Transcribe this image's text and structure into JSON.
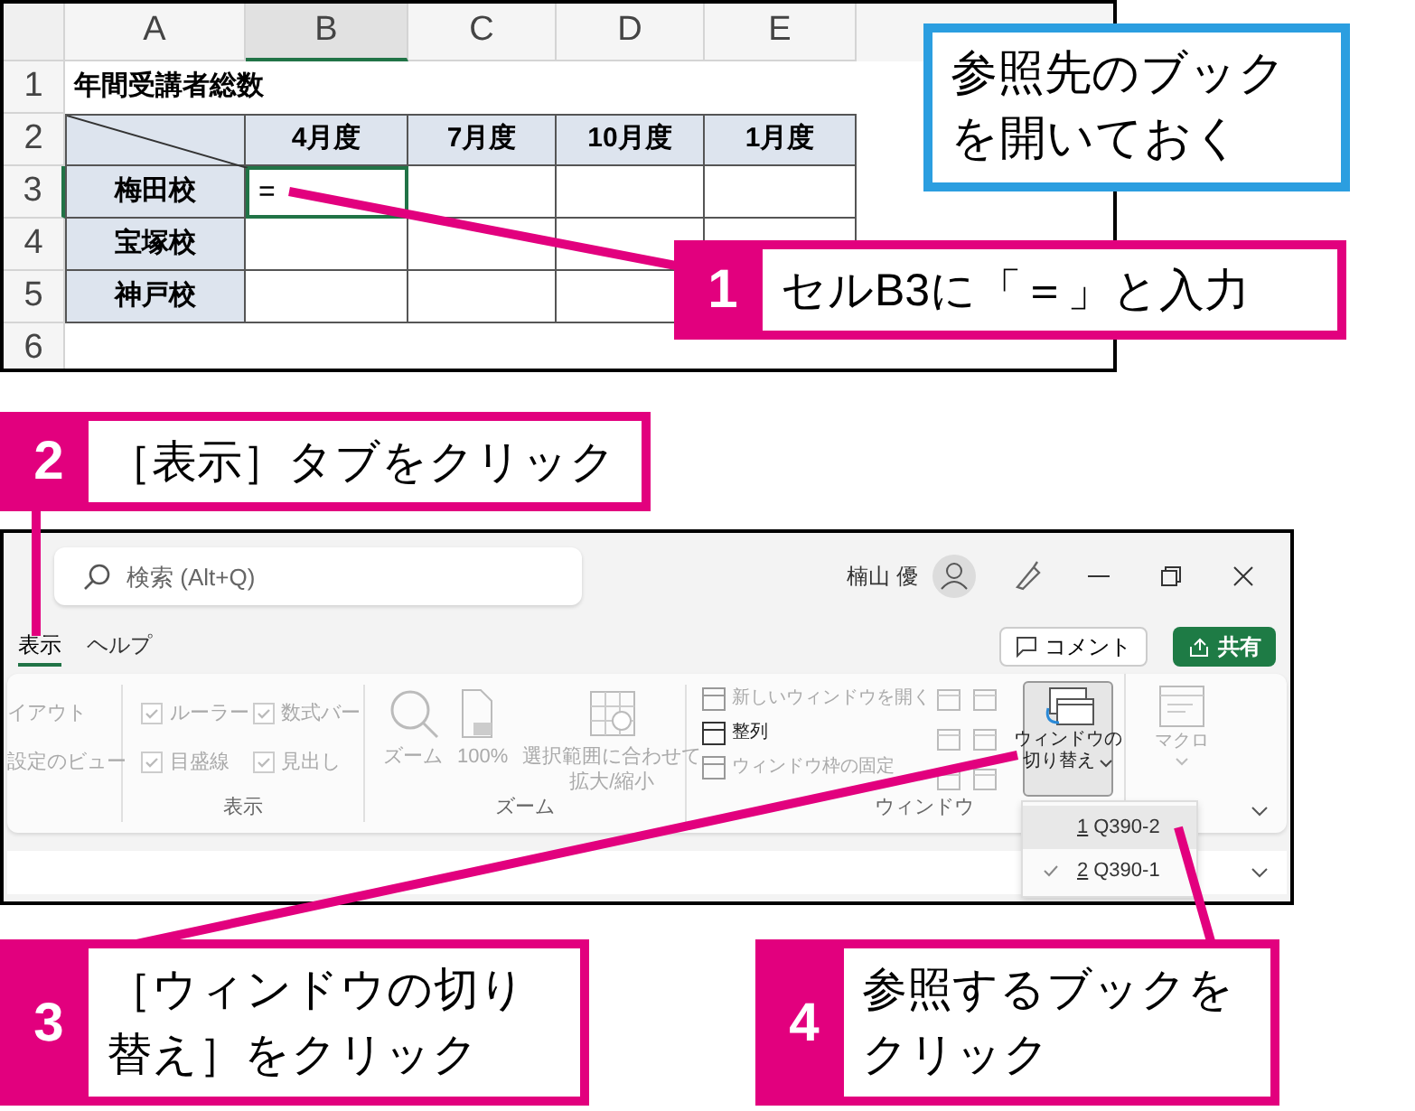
{
  "spreadsheet": {
    "columns": [
      {
        "label": "A",
        "selected": false
      },
      {
        "label": "B",
        "selected": true
      },
      {
        "label": "C",
        "selected": false
      },
      {
        "label": "D",
        "selected": false
      },
      {
        "label": "E",
        "selected": false
      }
    ],
    "rows": [
      {
        "kind": "title",
        "number": "1",
        "selected": false,
        "text": "年間受講者総数"
      },
      {
        "kind": "header",
        "number": "2",
        "selected": false,
        "headers": [
          "4月度",
          "7月度",
          "10月度",
          "1月度"
        ]
      },
      {
        "kind": "data",
        "number": "3",
        "selected": true,
        "label": "梅田校",
        "values": [
          "="
        ]
      },
      {
        "kind": "data",
        "number": "4",
        "selected": false,
        "label": "宝塚校"
      },
      {
        "kind": "data",
        "number": "5",
        "selected": false,
        "label": "神戸校"
      },
      {
        "kind": "empty",
        "number": "6",
        "selected": false
      }
    ]
  },
  "note": "参照先のブックを開いておく",
  "excel": {
    "search": {
      "placeholder": "検索 (Alt+Q)"
    },
    "user": "楠山 優",
    "tabs": [
      {
        "label": "表示",
        "selected": true
      },
      {
        "label": "ヘルプ",
        "selected": false
      }
    ],
    "comment_button": "コメント",
    "share_button": "共有",
    "groups": [
      {
        "kind": "partial",
        "items": [
          "イアウト",
          "設定のビュー"
        ]
      },
      {
        "kind": "checkboxes",
        "label": "表示",
        "items": [
          {
            "label": "ルーラー",
            "checked": true
          },
          {
            "label": "数式バー",
            "checked": true
          },
          {
            "label": "目盛線",
            "checked": true
          },
          {
            "label": "見出し",
            "checked": true
          }
        ]
      },
      {
        "kind": "zoom",
        "label": "ズーム",
        "buttons": [
          {
            "lines": [
              "ズーム"
            ]
          },
          {
            "lines": [
              "100%"
            ]
          },
          {
            "lines": [
              "選択範囲に合わせて",
              "拡大/縮小"
            ]
          }
        ]
      },
      {
        "kind": "window",
        "label": "ウィンドウ",
        "items": [
          {
            "label": "新しいウィンドウを開く",
            "disabled": true
          },
          {
            "label": "整列",
            "disabled": false
          },
          {
            "label": "ウィンドウ枠の固定",
            "disabled": true
          }
        ]
      },
      {
        "kind": "switch",
        "lines": [
          "ウィンドウの",
          "切り替え"
        ],
        "pressed": true
      },
      {
        "kind": "macro",
        "lines": [
          "マクロ"
        ]
      }
    ],
    "dropdown": [
      {
        "key": "1",
        "label": "Q390-2",
        "checked": false,
        "selected": true
      },
      {
        "key": "2",
        "label": "Q390-1",
        "checked": true,
        "selected": false
      }
    ]
  },
  "steps": [
    {
      "number": "1",
      "text": "セルB3に「＝」と入力"
    },
    {
      "number": "2",
      "text": "［表示］タブをクリック"
    },
    {
      "number": "3",
      "text": "［ウィンドウの切り替え］をクリック"
    },
    {
      "number": "4",
      "text": "参照するブックをクリック"
    }
  ]
}
